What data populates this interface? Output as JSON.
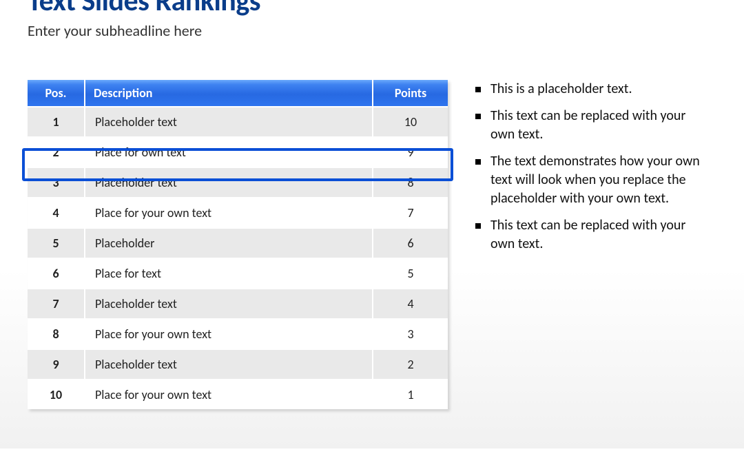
{
  "title": "Text Slides Rankings",
  "subtitle": "Enter your subheadline here",
  "table": {
    "headers": {
      "pos": "Pos.",
      "desc": "Description",
      "pts": "Points"
    },
    "rows": [
      {
        "pos": "1",
        "desc": "Placeholder text",
        "pts": "10"
      },
      {
        "pos": "2",
        "desc": "Place for own text",
        "pts": "9"
      },
      {
        "pos": "3",
        "desc": "Placeholder text",
        "pts": "8"
      },
      {
        "pos": "4",
        "desc": "Place for your own text",
        "pts": "7"
      },
      {
        "pos": "5",
        "desc": "Placeholder",
        "pts": "6"
      },
      {
        "pos": "6",
        "desc": "Place for text",
        "pts": "5"
      },
      {
        "pos": "7",
        "desc": "Placeholder text",
        "pts": "4"
      },
      {
        "pos": "8",
        "desc": "Place for your own text",
        "pts": "3"
      },
      {
        "pos": "9",
        "desc": "Placeholder text",
        "pts": "2"
      },
      {
        "pos": "10",
        "desc": "Place for your own text",
        "pts": "1"
      }
    ],
    "highlighted_row_index": 2
  },
  "bullets": [
    "This is a placeholder text.",
    "This text can be replaced with your own text.",
    "The text demonstrates how your own text will look when you replace the placeholder with your own text.",
    "This text can be replaced with your own text."
  ]
}
